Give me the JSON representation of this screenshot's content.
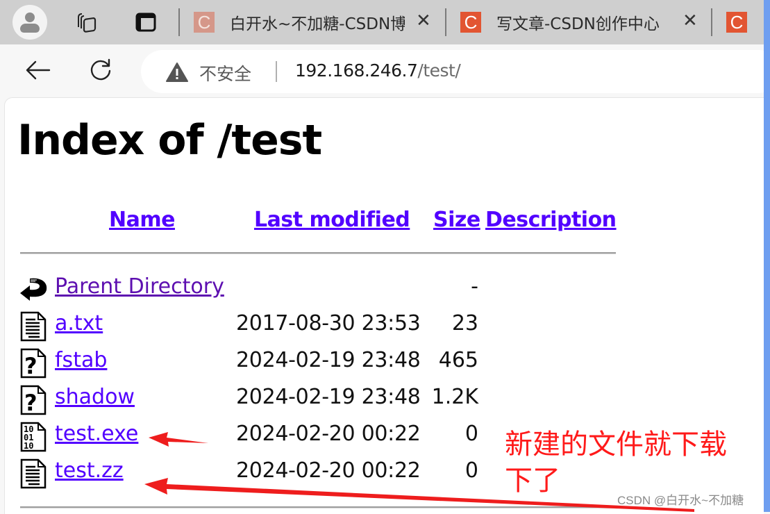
{
  "browser": {
    "tabs": [
      {
        "title": "白开水~不加糖-CSDN博",
        "favicon": "C",
        "active": false,
        "dim_icon": true
      },
      {
        "title": "写文章-CSDN创作中心",
        "favicon": "C",
        "active": false,
        "dim_icon": false
      },
      {
        "title": "",
        "favicon": "C",
        "active": false,
        "dim_icon": false
      }
    ],
    "close_glyph": "✕",
    "security_label": "不安全",
    "url_host": "192.168.246.7",
    "url_path": "/test/"
  },
  "page": {
    "title": "Index of /test",
    "columns": {
      "name": "Name",
      "last_modified": "Last modified",
      "size": "Size",
      "description": "Description"
    },
    "rows": [
      {
        "name": "Parent Directory",
        "date": "",
        "size": "-",
        "icon": "back-icon",
        "visited": true
      },
      {
        "name": "a.txt",
        "date": "2017-08-30 23:53",
        "size": "23",
        "icon": "text-file-icon",
        "visited": false
      },
      {
        "name": "fstab",
        "date": "2024-02-19 23:48",
        "size": "465",
        "icon": "unknown-file-icon",
        "visited": false
      },
      {
        "name": "shadow",
        "date": "2024-02-19 23:48",
        "size": "1.2K",
        "icon": "unknown-file-icon",
        "visited": false
      },
      {
        "name": "test.exe",
        "date": "2024-02-20 00:22",
        "size": "0",
        "icon": "binary-file-icon",
        "visited": false
      },
      {
        "name": "test.zz",
        "date": "2024-02-20 00:22",
        "size": "0",
        "icon": "text-file-icon",
        "visited": false
      }
    ]
  },
  "annotation": {
    "text": "新建的文件就下载下了",
    "color": "#ff1a1a"
  },
  "watermark": "CSDN @白开水~不加糖",
  "colors": {
    "link": "#5200ff",
    "visited_link": "#5d0fb0",
    "favicon": "#e25532",
    "scroll_edge": "#6e9ef0"
  }
}
